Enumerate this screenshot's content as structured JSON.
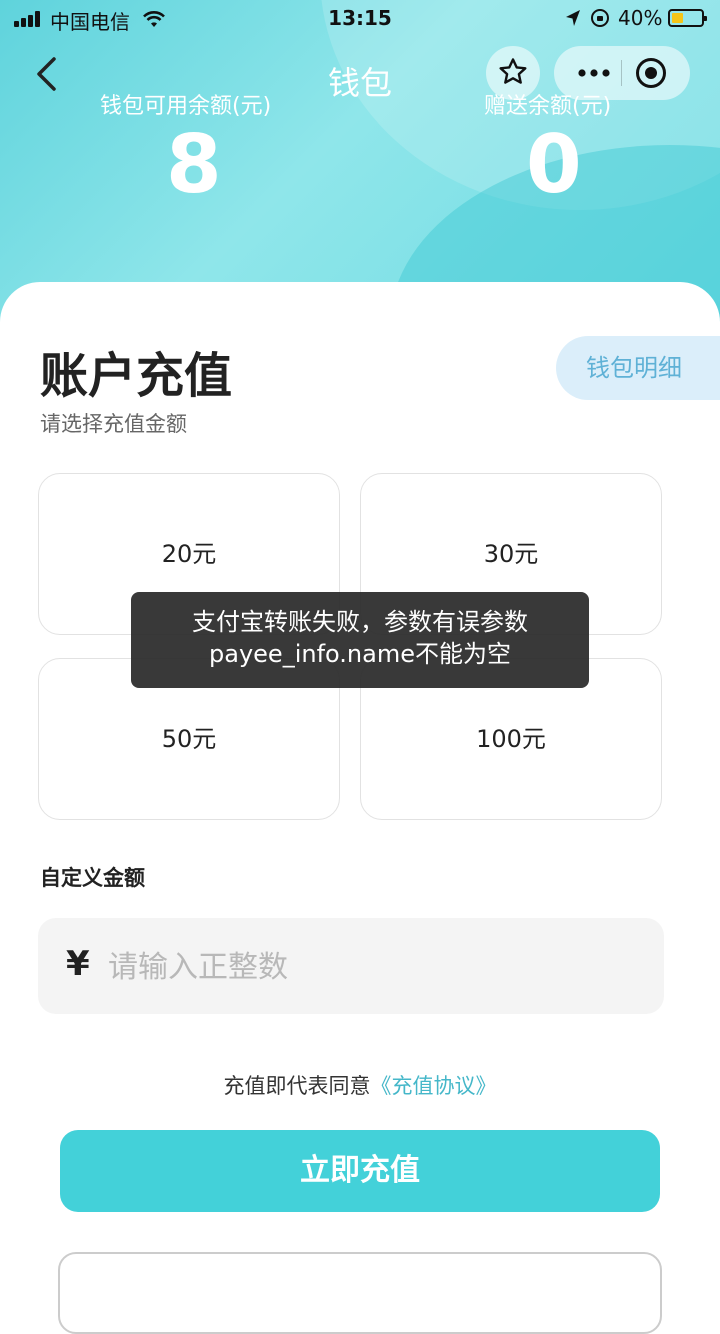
{
  "status_bar": {
    "carrier": "中国电信",
    "time": "13:15",
    "battery": "40%"
  },
  "nav": {
    "title": "钱包"
  },
  "balances": {
    "available_label": "钱包可用余额(元)",
    "available_value": "8",
    "gift_label": "赠送余额(元)",
    "gift_value": "0"
  },
  "recharge": {
    "title": "账户充值",
    "subtitle": "请选择充值金额",
    "detail_button": "钱包明细",
    "amounts": [
      "20元",
      "30元",
      "50元",
      "100元"
    ],
    "custom_label": "自定义金额",
    "currency_symbol": "¥",
    "custom_placeholder": "请输入正整数",
    "agreement_prefix": "充值即代表同意",
    "agreement_link": "《充值协议》",
    "submit_button": "立即充值"
  },
  "toast": {
    "line1": "支付宝转账失败，参数有误参数",
    "line2": "payee_info.name不能为空"
  },
  "colors": {
    "accent": "#43d1d9",
    "link": "#45b7c9",
    "detail_bg": "#dbeefa"
  }
}
